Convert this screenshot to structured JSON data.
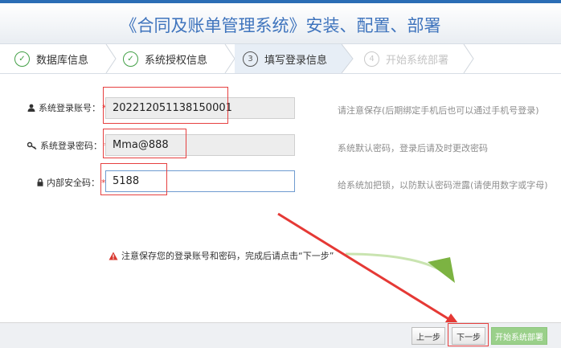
{
  "header": {
    "title": "《合同及账单管理系统》安装、配置、部署"
  },
  "steps": [
    {
      "label": "数据库信息",
      "state": "done",
      "marker": "✓"
    },
    {
      "label": "系统授权信息",
      "state": "done",
      "marker": "✓"
    },
    {
      "label": "填写登录信息",
      "state": "current",
      "marker": "3"
    },
    {
      "label": "开始系统部署",
      "state": "disabled",
      "marker": "4"
    }
  ],
  "form": {
    "account": {
      "label": "系统登录账号：",
      "required": "*",
      "value": "202212051138150001",
      "hint": "请注意保存(后期绑定手机后也可以通过手机号登录)"
    },
    "password": {
      "label": "系统登录密码：",
      "required": "*",
      "value": "Mma@888",
      "hint": "系统默认密码，登录后请及时更改密码"
    },
    "security": {
      "label": "内部安全码：",
      "required": "*",
      "value": "5188",
      "hint": "给系统加把锁，以防默认密码泄露(请使用数字或字母)"
    }
  },
  "notice": "注意保存您的登录账号和密码，完成后请点击“下一步”",
  "buttons": {
    "prev": "上一步",
    "next": "下一步",
    "deploy": "开始系统部署"
  },
  "colors": {
    "header_text": "#3f74bd",
    "done": "#43a047",
    "annotation_red": "#e64040",
    "annotation_green": "#7cb342"
  },
  "icons": {
    "account": "user-icon",
    "password": "key-icon",
    "security": "lock-icon",
    "notice": "warning-icon"
  }
}
